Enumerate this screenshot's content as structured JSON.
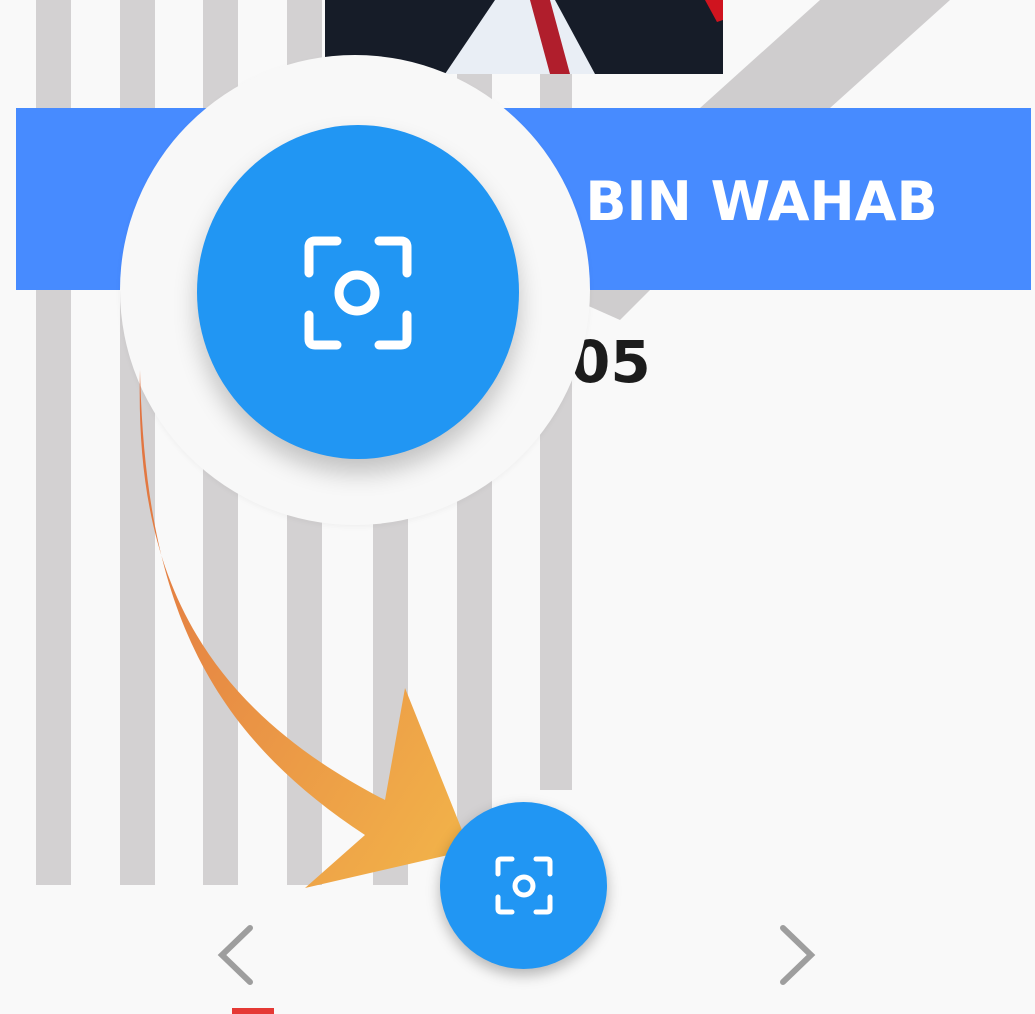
{
  "id_card": {
    "name_visible": "R BIN WAHAB",
    "id_visible": "05"
  },
  "icons": {
    "zoomed_scan": "camera-scan-icon",
    "scan": "camera-scan-icon",
    "prev": "chevron-left-icon",
    "next": "chevron-right-icon",
    "pointer": "curved-arrow-icon"
  },
  "colors": {
    "banner": "#478bff",
    "fab": "#2196f3",
    "stripes": "#d3d1d2",
    "indicator": "#e53935",
    "arrow_start": "#e07040",
    "arrow_end": "#f3b64a"
  }
}
